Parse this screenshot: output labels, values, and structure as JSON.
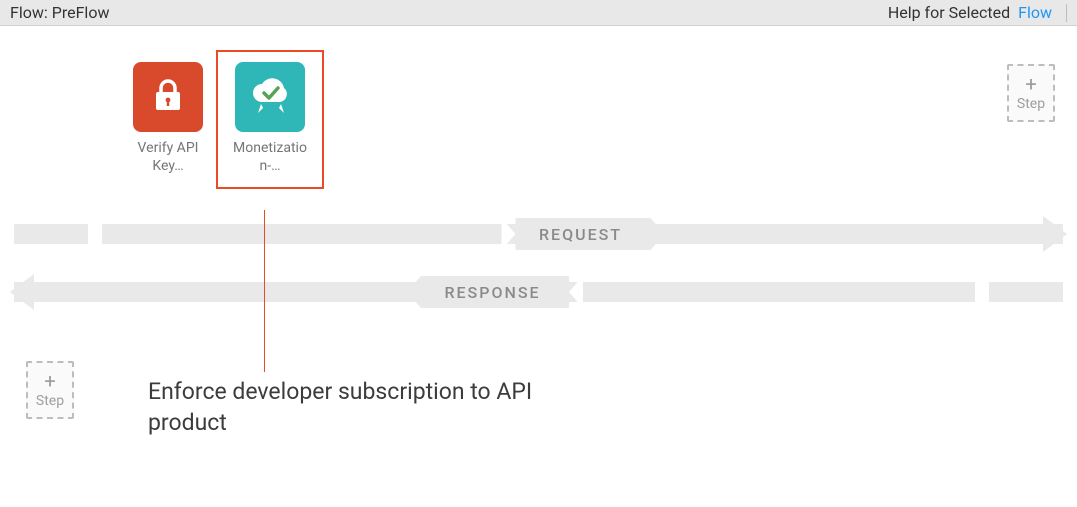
{
  "topbar": {
    "title": "Flow: PreFlow",
    "help_label": "Help for Selected",
    "flow_link": "Flow"
  },
  "policies": [
    {
      "label": "Verify API Key…",
      "icon": "lock-icon",
      "selected": false,
      "color": "red"
    },
    {
      "label": "Monetization-…",
      "icon": "cloud-check-icon",
      "selected": true,
      "color": "teal"
    }
  ],
  "bands": {
    "request_label": "REQUEST",
    "response_label": "RESPONSE"
  },
  "add_step": {
    "plus": "+",
    "label": "Step"
  },
  "callout": {
    "text": "Enforce developer subscription to API product"
  }
}
